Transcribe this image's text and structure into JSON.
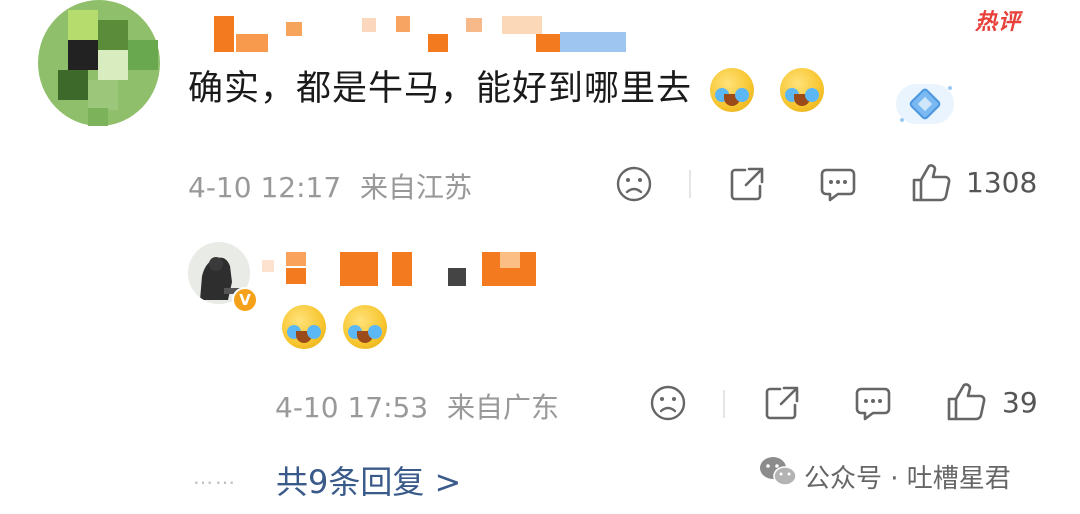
{
  "hot_badge": "热评",
  "main_comment": {
    "text": "确实，都是牛马，能好到哪里去",
    "emojis": [
      "laugh-cry-emoji",
      "laugh-cry-emoji"
    ],
    "date": "4-10 12:17",
    "location": "来自江苏",
    "like_count": "1308"
  },
  "reply": {
    "emojis": [
      "laugh-cry-emoji",
      "laugh-cry-emoji"
    ],
    "verified_badge": "V",
    "date": "4-10 17:53",
    "location": "来自广东",
    "like_count": "39"
  },
  "more_replies": "共9条回复 >",
  "more_dots": "……",
  "watermark": "公众号 · 吐槽星君",
  "icons": {
    "dislike": "frown-face-icon",
    "share": "share-icon",
    "comment": "comment-bubble-icon",
    "like": "thumbs-up-icon",
    "wechat": "wechat-logo-icon",
    "fan_badge": "diamond-badge-icon"
  },
  "colors": {
    "accent_red": "#e8413b",
    "link_blue": "#3a5a8a",
    "meta_gray": "#999999",
    "verified_orange": "#f5a21a",
    "censor_orange": "#f47a20"
  }
}
